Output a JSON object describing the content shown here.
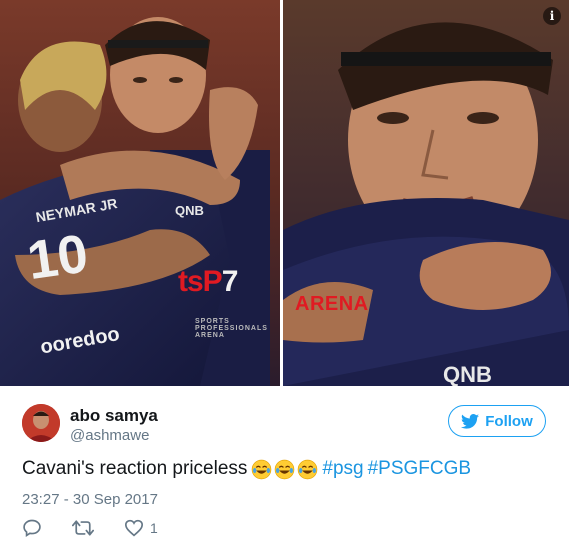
{
  "media": {
    "watermark": {
      "brand_red": "tsP",
      "brand_white": "7",
      "arena": "ARENA",
      "subtitle": "SPORTS PROFESSIONALS ARENA"
    },
    "info_icon": "i"
  },
  "author": {
    "display_name": "abo samya",
    "handle": "@ashmawe"
  },
  "follow_label": "Follow",
  "tweet": {
    "text": "Cavani's reaction priceless",
    "hashtag1": "#psg",
    "hashtag2": "#PSGFCGB"
  },
  "timestamp": "23:27 - 30 Sep 2017",
  "actions": {
    "like_count": "1"
  },
  "colors": {
    "twitter_blue": "#1da1f2",
    "hashtag": "#1b95e0",
    "muted": "#657786",
    "watermark_red": "#e01a22"
  }
}
